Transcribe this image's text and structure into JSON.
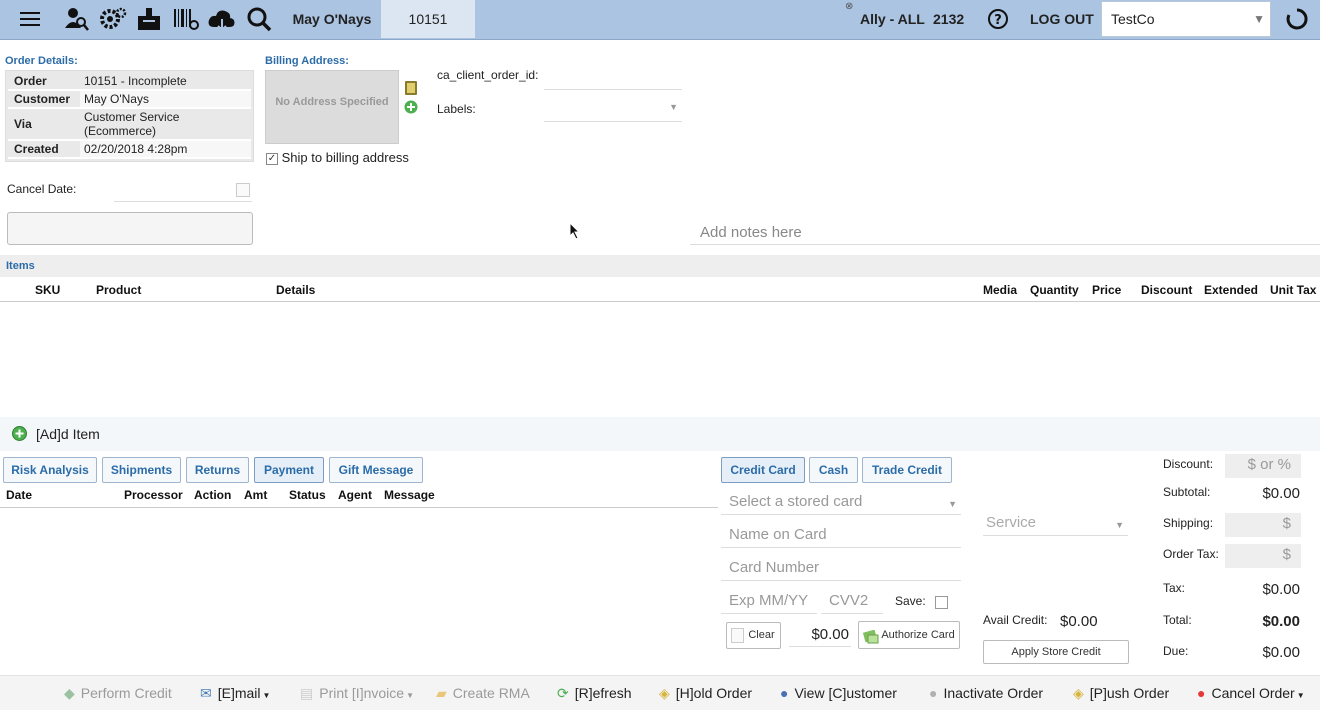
{
  "topbar": {
    "customer_name": "May O'Nays",
    "order_tab": "10151",
    "user": "Ally - ALL",
    "count": "2132",
    "logout": "LOG OUT",
    "company": "TestCo",
    "icons": [
      "menu-icon",
      "user-search-icon",
      "gear-icon",
      "box-icon",
      "barcode-icon",
      "cloud-icon",
      "search-icon",
      "help-icon",
      "refresh-icon"
    ]
  },
  "order_details": {
    "title": "Order Details:",
    "rows": [
      {
        "k": "Order",
        "v": "10151 - Incomplete"
      },
      {
        "k": "Customer",
        "v": "May O'Nays"
      },
      {
        "k": "Via",
        "v": "Customer Service (Ecommerce)"
      },
      {
        "k": "Created",
        "v": "02/20/2018 4:28pm"
      }
    ],
    "cancel_date_label": "Cancel Date:"
  },
  "billing": {
    "title": "Billing Address:",
    "no_address": "No Address Specified",
    "ship_to_billing": "Ship to billing address"
  },
  "meta": {
    "client_order_id_label": "ca_client_order_id:",
    "labels_label": "Labels:"
  },
  "notes_placeholder": "Add notes here",
  "items": {
    "title": "Items",
    "columns": [
      "SKU",
      "Product",
      "Details",
      "Media",
      "Quantity",
      "Price",
      "Discount",
      "Extended",
      "Unit Tax"
    ],
    "add_item": "[Ad]d Item"
  },
  "payment_tabs": [
    "Risk Analysis",
    "Shipments",
    "Returns",
    "Payment",
    "Gift Message"
  ],
  "payment_columns": [
    "Date",
    "Processor",
    "Action",
    "Amt",
    "Status",
    "Agent",
    "Message"
  ],
  "card_tabs": [
    "Credit Card",
    "Cash",
    "Trade Credit"
  ],
  "card_form": {
    "stored_card": "Select a stored card",
    "name_on_card": "Name on Card",
    "card_number": "Card Number",
    "exp": "Exp MM/YY",
    "cvv": "CVV2",
    "save_label": "Save:",
    "clear": "Clear",
    "amount": "$0.00",
    "authorize": "Authorize Card",
    "service": "Service",
    "avail_credit_label": "Avail Credit:",
    "avail_credit_value": "$0.00",
    "apply_store_credit": "Apply Store Credit"
  },
  "totals": {
    "discount_label": "Discount:",
    "discount_placeholder": "$ or %",
    "subtotal_label": "Subtotal:",
    "subtotal": "$0.00",
    "shipping_label": "Shipping:",
    "shipping_placeholder": "$",
    "order_tax_label": "Order Tax:",
    "order_tax_placeholder": "$",
    "tax_label": "Tax:",
    "tax": "$0.00",
    "total_label": "Total:",
    "total": "$0.00",
    "due_label": "Due:",
    "due": "$0.00"
  },
  "bottom_actions": [
    {
      "label": "Perform Credit",
      "enabled": false
    },
    {
      "label": "[E]mail",
      "enabled": true
    },
    {
      "label": "Print [I]nvoice",
      "enabled": false
    },
    {
      "label": "Create RMA",
      "enabled": false
    },
    {
      "label": "[R]efresh",
      "enabled": true
    },
    {
      "label": "[H]old Order",
      "enabled": true
    },
    {
      "label": "View [C]ustomer",
      "enabled": true
    },
    {
      "label": "Inactivate Order",
      "enabled": true
    },
    {
      "label": "[P]ush Order",
      "enabled": true
    },
    {
      "label": "Cancel Order",
      "enabled": true
    }
  ]
}
